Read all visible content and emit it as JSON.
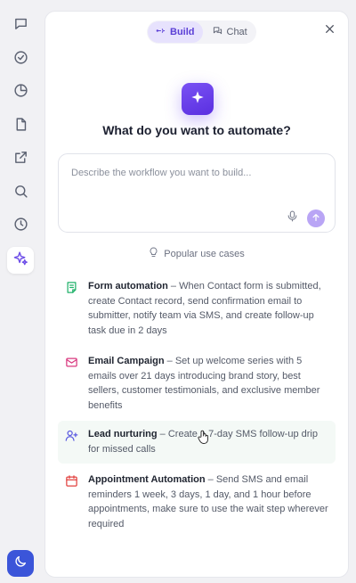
{
  "tabs": [
    {
      "label": "Build",
      "active": true,
      "icon": "sparkle-build-icon"
    },
    {
      "label": "Chat",
      "active": false,
      "icon": "chat-bubbles-icon"
    }
  ],
  "rail_icons": [
    "chat-icon",
    "check-circle-icon",
    "pie-chart-icon",
    "file-icon",
    "external-link-icon",
    "search-icon",
    "history-icon",
    "sparkles-icon"
  ],
  "heading": "What do you want to automate?",
  "prompt": {
    "placeholder": "Describe the workflow you want to build...",
    "value": ""
  },
  "popular_label": "Popular use cases",
  "use_cases": [
    {
      "title": "Form automation",
      "separator": " – ",
      "description": "When Contact form is submitted, create Contact record, send confirmation email to submitter, notify team via SMS, and create follow-up task due in 2 days",
      "icon": "form-icon",
      "icon_color": "#22b26b"
    },
    {
      "title": "Email Campaign",
      "separator": " – ",
      "description": "Set up welcome series with 5 emails over 21 days introducing brand story, best sellers, customer testimonials, and exclusive member benefits",
      "icon": "mail-icon",
      "icon_color": "#d9387f"
    },
    {
      "title": "Lead nurturing",
      "separator": " – ",
      "description": "Create a 7-day SMS follow-up drip for missed calls",
      "icon": "user-plus-icon",
      "icon_color": "#5b5be0"
    },
    {
      "title": "Appointment Automation",
      "separator": " – ",
      "description": "Send SMS and email reminders 1 week, 3 days, 1 day, and 1 hour before appointments, make sure to use the wait step wherever required",
      "icon": "calendar-icon",
      "icon_color": "#e2413f"
    }
  ],
  "colors": {
    "accent": "#6d4de8",
    "theme_button": "#3b55d9"
  }
}
